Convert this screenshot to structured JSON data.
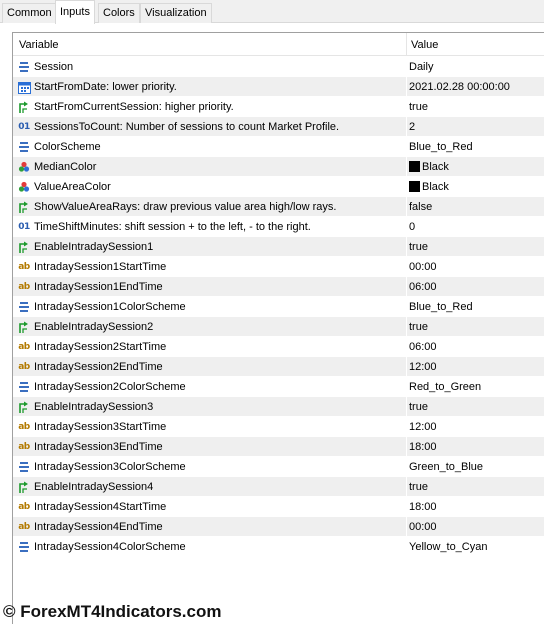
{
  "tabs": [
    "Common",
    "Inputs",
    "Colors",
    "Visualization"
  ],
  "active_tab": "Inputs",
  "headers": {
    "variable": "Variable",
    "value": "Value"
  },
  "rows": [
    {
      "icon": "enum-icon",
      "name": "Session",
      "value": "Daily"
    },
    {
      "icon": "calendar-icon",
      "name": "StartFromDate: lower priority.",
      "value": "2021.02.28 00:00:00"
    },
    {
      "icon": "bool-icon",
      "name": "StartFromCurrentSession: higher priority.",
      "value": "true"
    },
    {
      "icon": "int-icon",
      "name": "SessionsToCount: Number of sessions to count Market Profile.",
      "value": "2"
    },
    {
      "icon": "enum-icon",
      "name": "ColorScheme",
      "value": "Blue_to_Red"
    },
    {
      "icon": "color-icon",
      "name": "MedianColor",
      "value": "Black",
      "swatch": "#000000"
    },
    {
      "icon": "color-icon",
      "name": "ValueAreaColor",
      "value": "Black",
      "swatch": "#000000"
    },
    {
      "icon": "bool-icon",
      "name": "ShowValueAreaRays: draw previous value area high/low rays.",
      "value": "false"
    },
    {
      "icon": "int-icon",
      "name": "TimeShiftMinutes: shift session + to the left, - to the right.",
      "value": "0"
    },
    {
      "icon": "bool-icon",
      "name": "EnableIntradaySession1",
      "value": "true"
    },
    {
      "icon": "string-icon",
      "name": "IntradaySession1StartTime",
      "value": "00:00"
    },
    {
      "icon": "string-icon",
      "name": "IntradaySession1EndTime",
      "value": "06:00"
    },
    {
      "icon": "enum-icon",
      "name": "IntradaySession1ColorScheme",
      "value": "Blue_to_Red"
    },
    {
      "icon": "bool-icon",
      "name": "EnableIntradaySession2",
      "value": "true"
    },
    {
      "icon": "string-icon",
      "name": "IntradaySession2StartTime",
      "value": "06:00"
    },
    {
      "icon": "string-icon",
      "name": "IntradaySession2EndTime",
      "value": "12:00"
    },
    {
      "icon": "enum-icon",
      "name": "IntradaySession2ColorScheme",
      "value": "Red_to_Green"
    },
    {
      "icon": "bool-icon",
      "name": "EnableIntradaySession3",
      "value": "true"
    },
    {
      "icon": "string-icon",
      "name": "IntradaySession3StartTime",
      "value": "12:00"
    },
    {
      "icon": "string-icon",
      "name": "IntradaySession3EndTime",
      "value": "18:00"
    },
    {
      "icon": "enum-icon",
      "name": "IntradaySession3ColorScheme",
      "value": "Green_to_Blue"
    },
    {
      "icon": "bool-icon",
      "name": "EnableIntradaySession4",
      "value": "true"
    },
    {
      "icon": "string-icon",
      "name": "IntradaySession4StartTime",
      "value": "18:00"
    },
    {
      "icon": "string-icon",
      "name": "IntradaySession4EndTime",
      "value": "00:00"
    },
    {
      "icon": "enum-icon",
      "name": "IntradaySession4ColorScheme",
      "value": "Yellow_to_Cyan"
    }
  ],
  "watermark": "© ForexMT4Indicators.com"
}
